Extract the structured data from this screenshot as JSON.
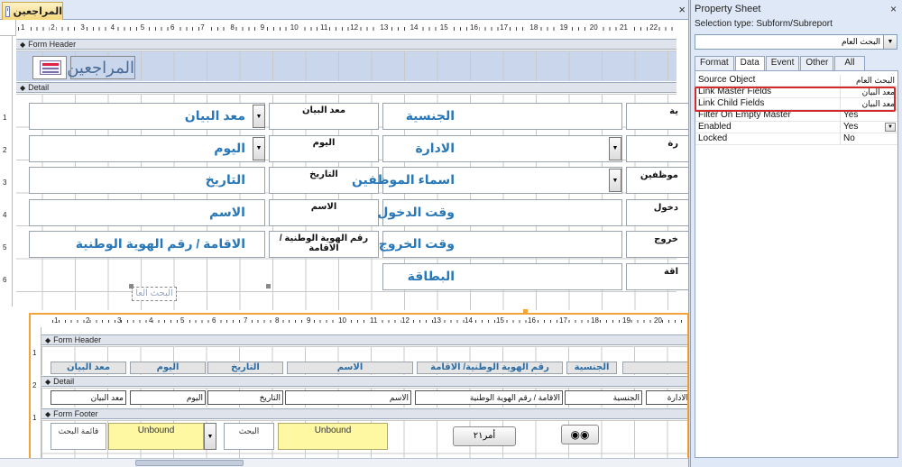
{
  "document_tab": {
    "title": "المراجعين",
    "close": "×"
  },
  "rulers": {
    "h": [
      "1",
      "2",
      "3",
      "4",
      "5",
      "6",
      "7",
      "8",
      "9",
      "10",
      "11",
      "12",
      "13",
      "14",
      "15",
      "16",
      "17",
      "18",
      "19",
      "20",
      "21",
      "22"
    ],
    "v": [
      "1",
      "2",
      "3",
      "4",
      "5",
      "6"
    ],
    "sub_h": [
      "1",
      "2",
      "3",
      "4",
      "5",
      "6",
      "7",
      "8",
      "9",
      "10",
      "11",
      "12",
      "13",
      "14",
      "15",
      "16",
      "17",
      "18",
      "19",
      "20"
    ],
    "sub_v": [
      "1",
      "2",
      "1"
    ]
  },
  "sections": {
    "form_header": "Form Header",
    "detail": "Detail",
    "form_footer": "Form Footer"
  },
  "header": {
    "title": "المراجعين"
  },
  "detail_fields": [
    {
      "label": "معد البيان",
      "small": "معد البيان",
      "combo": true
    },
    {
      "label": "اليوم",
      "small": "اليوم",
      "combo": true
    },
    {
      "label": "التاريخ",
      "small": "التاريخ",
      "combo": false
    },
    {
      "label": "الاسم",
      "small": "الاسم",
      "combo": false
    },
    {
      "label": "الاقامة / رقم الهوية الوطنية",
      "small": "رقم الهوية الوطنية / الاقامة",
      "combo": false
    }
  ],
  "detail_fields_right": [
    {
      "label": "الجنسية",
      "small": "ية",
      "combo": false
    },
    {
      "label": "الادارة",
      "small": "رة",
      "combo": true
    },
    {
      "label": "اسماء الموظفين",
      "small": "موظفين",
      "combo": true
    },
    {
      "label": "وقت الدخول",
      "small": "دخول",
      "combo": false
    },
    {
      "label": "وقت الخروج",
      "small": "خروج",
      "combo": false
    },
    {
      "label": "البطاقة",
      "small": "اقة",
      "combo": false
    }
  ],
  "subform_control_label": "البحث العا",
  "subform": {
    "header_labels": [
      "معد البيان",
      "اليوم",
      "التاريخ",
      "الاسم",
      "رقم الهوية الوطنية/ الاقامة",
      "الجنسية"
    ],
    "detail_boxes": [
      "معد البيان",
      "اليوم",
      "التاريخ",
      "الاسم",
      "الاقامة / رقم الهوية الوطنية",
      "الجنسية",
      "الادارة"
    ],
    "footer": {
      "label1": "قائمة البحث",
      "unbound1": "Unbound",
      "label2": "البحث",
      "unbound2": "Unbound",
      "command_button": "أمر٢١"
    }
  },
  "property_sheet": {
    "title": "Property Sheet",
    "close": "×",
    "selection_type": "Selection type:  Subform/Subreport",
    "object": "البحث العام",
    "tabs": [
      "Format",
      "Data",
      "Event",
      "Other",
      "All"
    ],
    "active_tab": "Data",
    "rows": [
      {
        "key": "Source Object",
        "value": "البحث العام",
        "rtl": true
      },
      {
        "key": "Link Master Fields",
        "value": "معد البيان",
        "rtl": true
      },
      {
        "key": "Link Child Fields",
        "value": "معد البيان",
        "rtl": true
      },
      {
        "key": "Filter On Empty Master",
        "value": "Yes",
        "rtl": false
      },
      {
        "key": "Enabled",
        "value": "Yes",
        "rtl": false,
        "dropdown": true
      },
      {
        "key": "Locked",
        "value": "No",
        "rtl": false
      }
    ],
    "highlight_color": "#d42a2a"
  }
}
